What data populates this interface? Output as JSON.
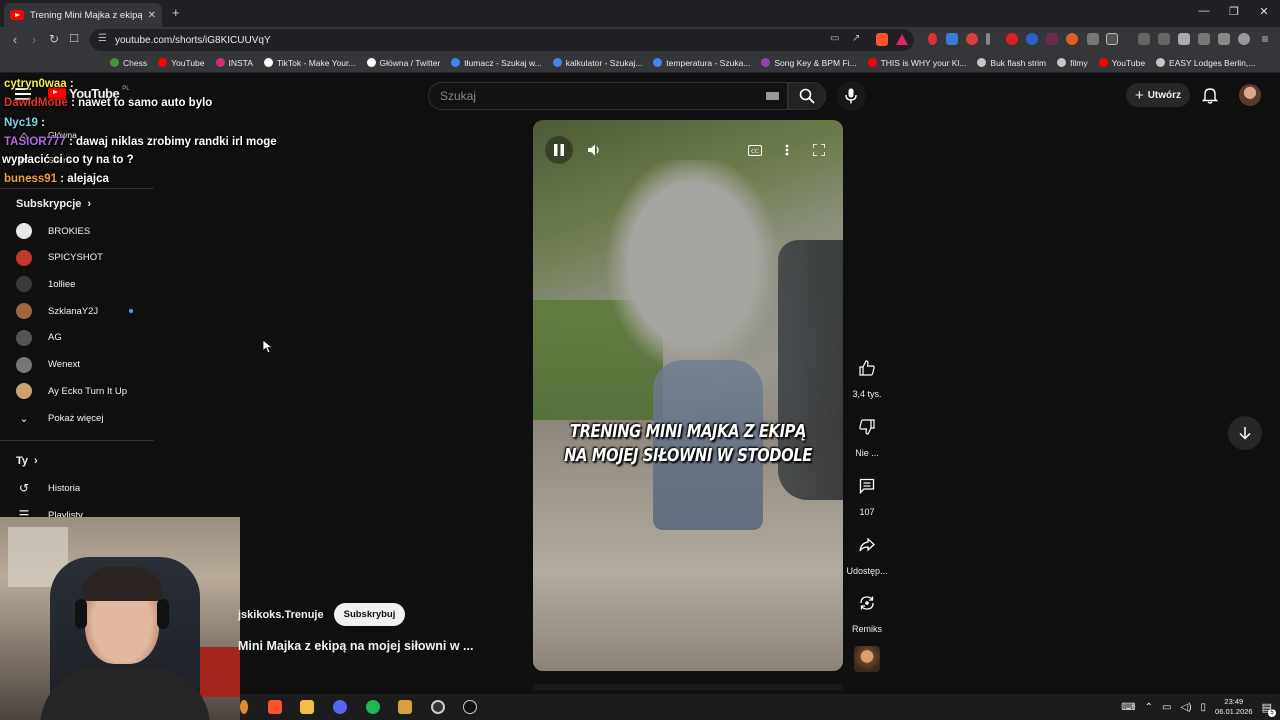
{
  "browser": {
    "tab_title": "Trening Mini Majka z ekipą n",
    "url": "youtube.com/shorts/iG8KICUUVqY",
    "bookmarks": [
      {
        "label": "Chess",
        "color": "#4b8f3a"
      },
      {
        "label": "YouTube",
        "color": "#ff0000"
      },
      {
        "label": "INSTA",
        "color": "#d62976"
      },
      {
        "label": "TikTok - Make Your...",
        "color": "#ffffff"
      },
      {
        "label": "Główna / Twitter",
        "color": "#ffffff"
      },
      {
        "label": "tłumacz - Szukaj w...",
        "color": "#4285f4"
      },
      {
        "label": "kalkulator - Szukaj...",
        "color": "#4285f4"
      },
      {
        "label": "temperatura - Szuka...",
        "color": "#4285f4"
      },
      {
        "label": "Song Key & BPM Fi...",
        "color": "#8e44ad"
      },
      {
        "label": "THIS is WHY your Kl...",
        "color": "#ff0000"
      },
      {
        "label": "Buk flash strim",
        "color": "#c4c7c5"
      },
      {
        "label": "filmy",
        "color": "#c4c7c5"
      },
      {
        "label": "YouTube",
        "color": "#ff0000"
      },
      {
        "label": "EASY Lodges Berlin,...",
        "color": "#c4c7c5"
      }
    ]
  },
  "youtube": {
    "logo_text": "YouTube",
    "logo_region": "PL",
    "search_placeholder": "Szukaj",
    "create_label": "Utwórz",
    "sidebar": {
      "home": "Główna",
      "shorts": "Shorts",
      "subscriptions_header": "Subskrypcje",
      "subscriptions": [
        {
          "name": "BROKIES",
          "color": "#e8e8e8"
        },
        {
          "name": "SPICYSHOT",
          "color": "#c0392b"
        },
        {
          "name": "1olliee",
          "color": "#3a3a3a"
        },
        {
          "name": "SzklanaY2J",
          "color": "#a0663c"
        },
        {
          "name": "AG",
          "color": "#555555"
        },
        {
          "name": "Wenext",
          "color": "#777777"
        },
        {
          "name": "Ay Ecko Turn It Up",
          "color": "#d0a070"
        }
      ],
      "show_more": "Pokaż więcej",
      "you_header": "Ty",
      "history": "Historia",
      "playlists": "Playlisty"
    },
    "video": {
      "caption_line1": "TRENING MINI MAJKA Z EKIPĄ",
      "caption_line2": "NA MOJEJ SIŁOWNI W STODOLE"
    },
    "actions": {
      "likes": "3,4 tys.",
      "dislike": "Nie ...",
      "comments": "107",
      "share": "Udostęp...",
      "remix": "Remiks"
    },
    "channel": "jskikoks.Trenuje",
    "subscribe": "Subskrybuj",
    "title": "Mini Majka z ekipą na mojej siłowni w ..."
  },
  "chat": [
    {
      "user": "cytryn0waa",
      "text": "",
      "color": "#f5f24a"
    },
    {
      "user": "DawidMoue",
      "text": "nawet to samo auto bylo",
      "color": "#e03030"
    },
    {
      "user": "Nyc19",
      "text": "",
      "color": "#7fd6e0"
    },
    {
      "user": "TASIOR777",
      "text": "dawaj niklas zrobimy randki irl moge",
      "color": "#b06ae0"
    },
    {
      "user": "",
      "text": "wypłacić ci co ty na to ?",
      "color": "#ffffff"
    },
    {
      "user": "buness91",
      "text": "alejajca",
      "color": "#f0a040"
    }
  ],
  "tray": {
    "time": "23:49",
    "date": "06.01.2026",
    "notifications": "5"
  }
}
